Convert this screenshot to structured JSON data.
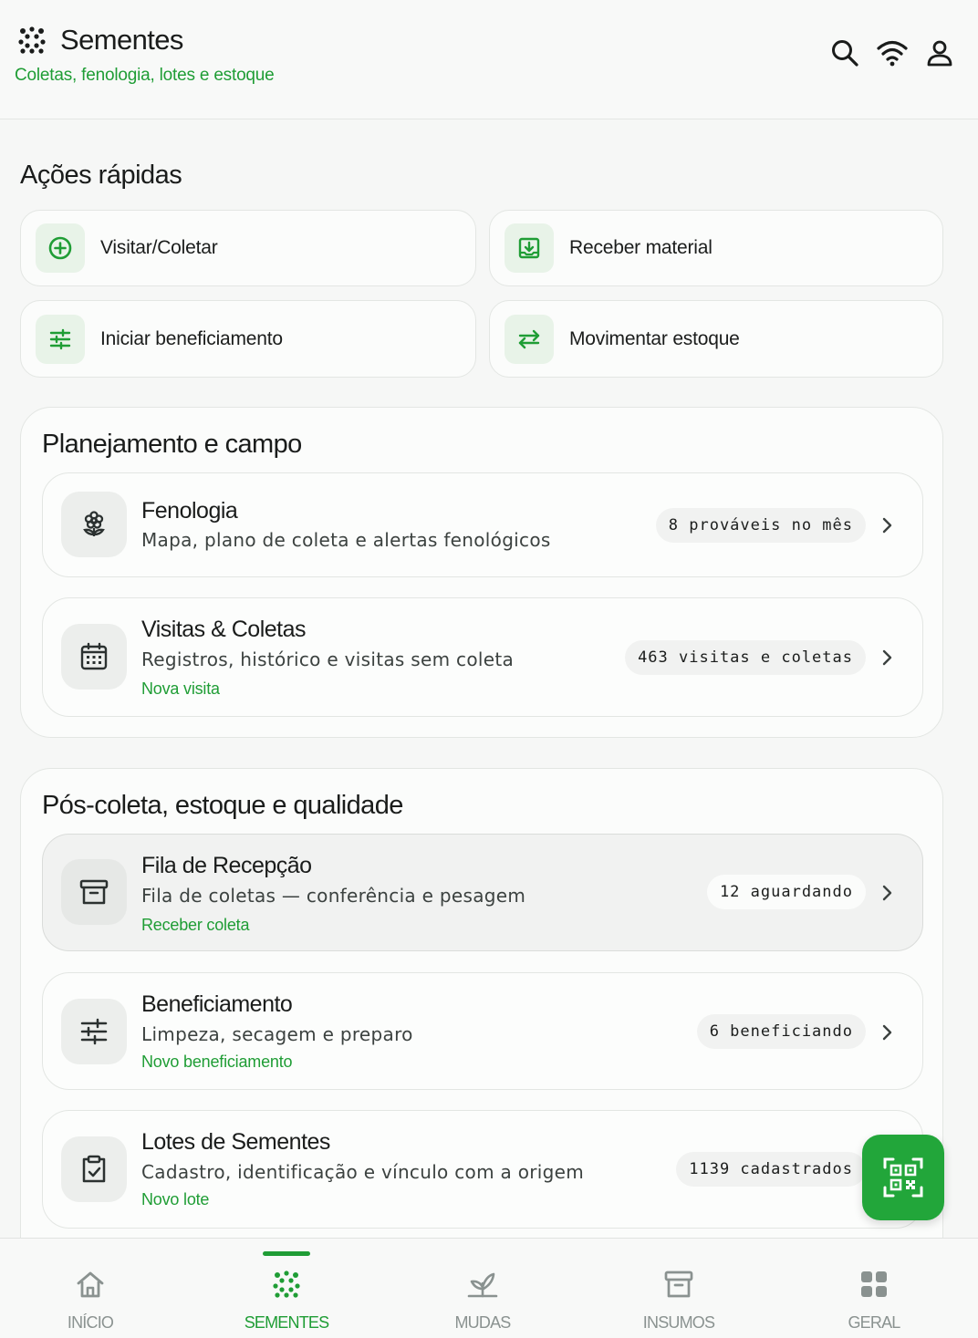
{
  "header": {
    "title": "Sementes",
    "subtitle": "Coletas, fenologia, lotes e estoque",
    "icons": [
      "search-icon",
      "wifi-icon",
      "user-icon"
    ]
  },
  "quick_actions": {
    "title": "Ações rápidas",
    "items": [
      {
        "label": "Visitar/Coletar",
        "icon": "plus-circle-icon"
      },
      {
        "label": "Receber material",
        "icon": "inbox-download-icon"
      },
      {
        "label": "Iniciar beneficiamento",
        "icon": "sliders-icon"
      },
      {
        "label": "Movimentar estoque",
        "icon": "swap-arrows-icon"
      }
    ]
  },
  "planning": {
    "title": "Planejamento e campo",
    "rows": [
      {
        "title": "Fenologia",
        "desc": "Mapa, plano de coleta e alertas fenológicos",
        "badge": "8 prováveis no mês",
        "icon": "flower-icon"
      },
      {
        "title": "Visitas & Coletas",
        "desc": "Registros, histórico e visitas sem coleta",
        "link": "Nova visita",
        "badge": "463 visitas e coletas",
        "icon": "calendar-icon"
      }
    ]
  },
  "post": {
    "title": "Pós-coleta, estoque e qualidade",
    "rows": [
      {
        "title": "Fila de Recepção",
        "desc": "Fila de coletas — conferência e pesagem",
        "link": "Receber coleta",
        "badge": "12 aguardando",
        "icon": "archive-box-icon"
      },
      {
        "title": "Beneficiamento",
        "desc": "Limpeza, secagem e preparo",
        "link": "Novo beneficiamento",
        "badge": "6 beneficiando",
        "icon": "sliders-icon"
      },
      {
        "title": "Lotes de Sementes",
        "desc": "Cadastro, identificação e vínculo com a origem",
        "link": "Novo lote",
        "badge": "1139 cadastrados",
        "icon": "clipboard-check-icon"
      }
    ]
  },
  "fab": {
    "icon": "qr-scan-icon"
  },
  "bottom_nav": [
    {
      "label": "INÍCIO",
      "icon": "home-icon"
    },
    {
      "label": "SEMENTES",
      "icon": "seeds-dots-icon",
      "active": true
    },
    {
      "label": "MUDAS",
      "icon": "sprout-icon"
    },
    {
      "label": "INSUMOS",
      "icon": "archive-box-icon"
    },
    {
      "label": "GERAL",
      "icon": "grid-icon"
    }
  ],
  "colors": {
    "accent": "#1f9d35",
    "fab": "#22a63a",
    "icon_bg_green": "#e8f3e8"
  }
}
